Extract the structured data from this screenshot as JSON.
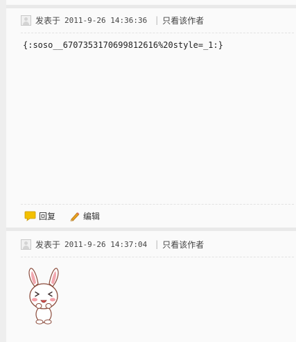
{
  "posts": [
    {
      "posted_label": "发表于",
      "time": "2011-9-26 14:36:36",
      "only_author": "只看该作者",
      "content": "{:soso__6707353170699812616%20style=_1:}",
      "actions": {
        "reply": "回复",
        "edit": "编辑"
      }
    },
    {
      "posted_label": "发表于",
      "time": "2011-9-26 14:37:04",
      "only_author": "只看该作者",
      "sticker_icon": "bunny-sticker-icon"
    }
  ],
  "colors": {
    "reply_icon": "#f3c000",
    "edit_pencil": "#e8a020",
    "separator": "#e9e9e9"
  }
}
